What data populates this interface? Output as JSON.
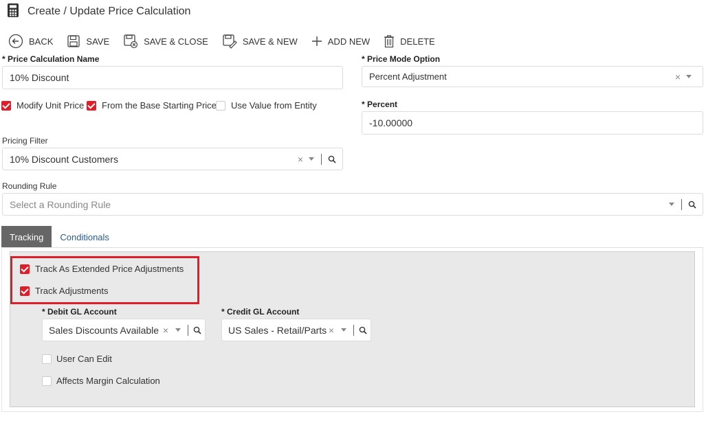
{
  "header": {
    "title": "Create / Update Price Calculation",
    "icon": "calculator-icon"
  },
  "toolbar": {
    "back": "BACK",
    "save": "SAVE",
    "save_close": "SAVE & CLOSE",
    "save_new": "SAVE & NEW",
    "add_new": "ADD NEW",
    "delete": "DELETE"
  },
  "form": {
    "name_label": "Price Calculation Name",
    "name_value": "10% Discount",
    "mode_label": "Price Mode Option",
    "mode_value": "Percent Adjustment",
    "modify_unit_price": {
      "label": "Modify Unit Price",
      "checked": true
    },
    "from_base_price": {
      "label": "From the Base Starting Price",
      "checked": true
    },
    "use_value_entity": {
      "label": "Use Value from Entity",
      "checked": false
    },
    "percent_label": "Percent",
    "percent_value": "-10.00000",
    "pricing_filter_label": "Pricing Filter",
    "pricing_filter_value": "10% Discount Customers",
    "rounding_label": "Rounding Rule",
    "rounding_placeholder": "Select a Rounding Rule",
    "required_mark": "*"
  },
  "tabs": [
    {
      "label": "Tracking",
      "active": true
    },
    {
      "label": "Conditionals",
      "active": false
    }
  ],
  "tracking": {
    "track_extended": {
      "label": "Track As Extended Price Adjustments",
      "checked": true
    },
    "track_adjustments": {
      "label": "Track Adjustments",
      "checked": true
    },
    "debit_label": "Debit GL Account",
    "debit_value": "Sales Discounts Available",
    "credit_label": "Credit GL Account",
    "credit_value": "US Sales - Retail/Parts",
    "user_can_edit": {
      "label": "User Can Edit",
      "checked": false
    },
    "affects_margin": {
      "label": "Affects Margin Calculation",
      "checked": false
    }
  },
  "colors": {
    "accent": "#e01e2a",
    "tab_active_bg": "#666666",
    "link": "#2a5a8a",
    "panel_bg": "#e9e9e9"
  }
}
